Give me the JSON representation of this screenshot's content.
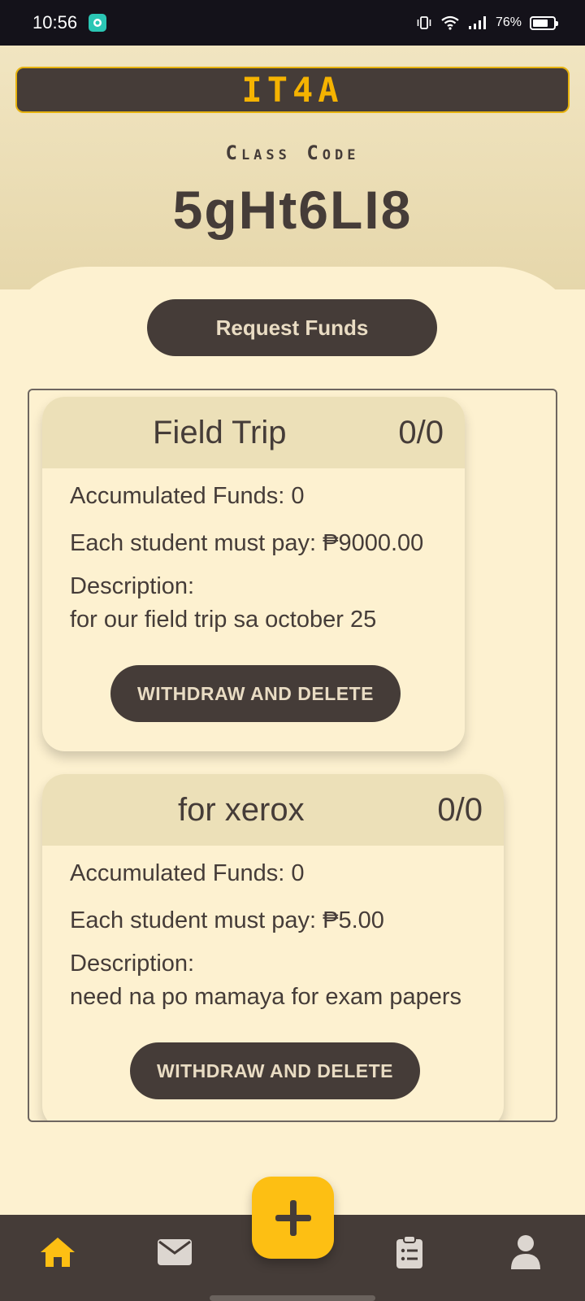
{
  "status_bar": {
    "time": "10:56",
    "battery_percent": "76%",
    "battery_level": 0.76,
    "icons": [
      "vibrate-icon",
      "wifi-icon",
      "signal-icon",
      "battery-icon"
    ]
  },
  "header": {
    "class_name": "IT4A",
    "class_code_label": "Class Code",
    "class_code": "5gHt6LI8"
  },
  "actions": {
    "request_funds_label": "Request Funds"
  },
  "funds": [
    {
      "title": "Field Trip",
      "count": "0/0",
      "accumulated": "Accumulated Funds: 0",
      "each_pay": "Each student must pay: ₱9000.00",
      "description_label": "Description:",
      "description": "for our field trip sa october 25",
      "withdraw_label": "WITHDRAW AND DELETE"
    },
    {
      "title": "for xerox",
      "count": "0/0",
      "accumulated": "Accumulated Funds: 0",
      "each_pay": "Each student must pay: ₱5.00",
      "description_label": "Description:",
      "description": "need na po mamaya for exam papers",
      "withdraw_label": "WITHDRAW AND DELETE"
    }
  ],
  "bottom_nav": {
    "items": [
      "home-icon",
      "mail-icon",
      "clipboard-list-icon",
      "profile-icon"
    ],
    "active": "home-icon",
    "fab_icon": "plus-icon"
  },
  "colors": {
    "accent": "#fdbf13",
    "dark": "#453c38",
    "background": "#fdf1d0",
    "card_header": "#ece0b8"
  }
}
